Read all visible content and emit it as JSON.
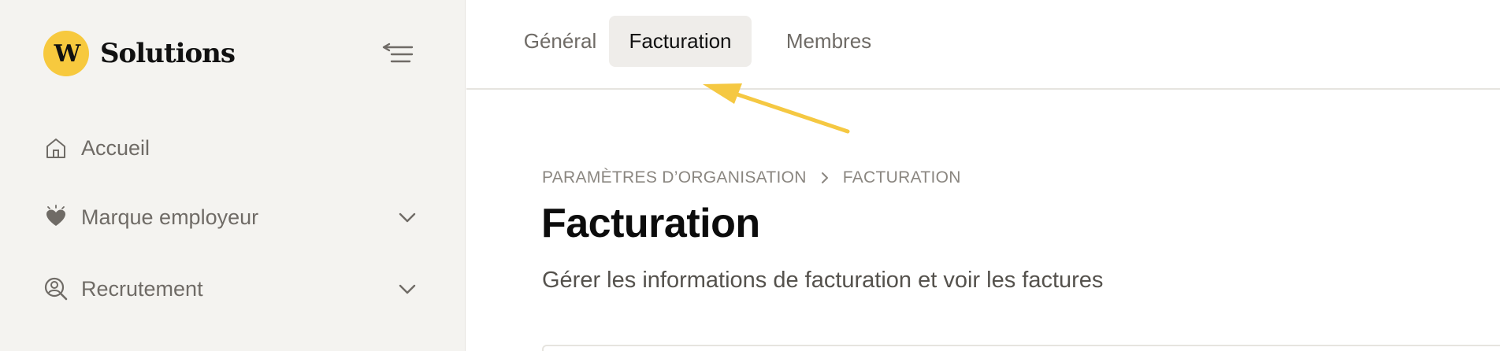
{
  "brand": {
    "logo_text": "W",
    "name": "Solutions",
    "accent": "#f7c93e"
  },
  "sidebar": {
    "items": [
      {
        "label": "Accueil",
        "icon": "home-icon",
        "expandable": false
      },
      {
        "label": "Marque employeur",
        "icon": "heart-sparkle-icon",
        "expandable": true
      },
      {
        "label": "Recrutement",
        "icon": "user-search-icon",
        "expandable": true
      }
    ]
  },
  "tabs": [
    {
      "label": "Général",
      "active": false
    },
    {
      "label": "Facturation",
      "active": true
    },
    {
      "label": "Membres",
      "active": false
    }
  ],
  "breadcrumb": {
    "parent": "PARAMÈTRES D’ORGANISATION",
    "current": "FACTURATION"
  },
  "page": {
    "title": "Facturation",
    "subtitle": "Gérer les informations de facturation et voir les factures"
  },
  "annotation": {
    "arrow_color": "#f5c842"
  }
}
